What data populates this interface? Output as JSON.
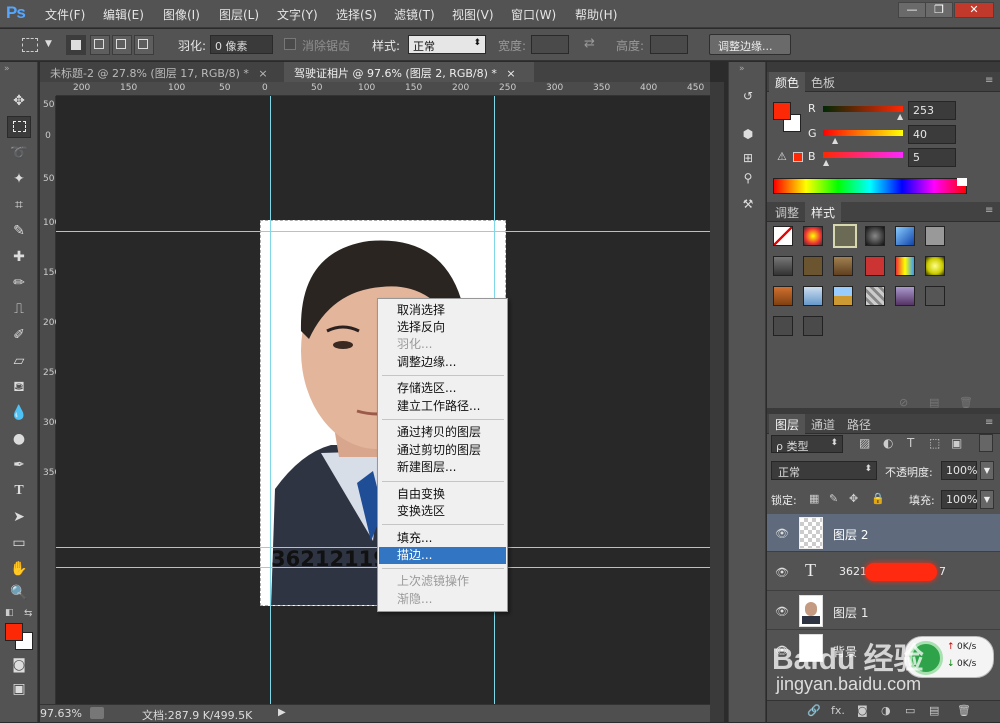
{
  "app": {
    "logo": "Ps"
  },
  "menubar": {
    "items": [
      "文件(F)",
      "编辑(E)",
      "图像(I)",
      "图层(L)",
      "文字(Y)",
      "选择(S)",
      "滤镜(T)",
      "视图(V)",
      "窗口(W)",
      "帮助(H)"
    ],
    "window_controls": [
      "—",
      "❐",
      "✕"
    ]
  },
  "options": {
    "feather_label": "羽化:",
    "feather_value": "0 像素",
    "antialias_label": "消除锯齿",
    "style_label": "样式:",
    "style_value": "正常",
    "width_label": "宽度:",
    "height_label": "高度:",
    "refine_button": "调整边缘..."
  },
  "tabs": [
    {
      "label": "未标题-2 @ 27.8% (图层 17, RGB/8) *",
      "close": "×"
    },
    {
      "label": "驾驶证相片 @ 97.6% (图层 2, RGB/8) *",
      "close": "×"
    }
  ],
  "ruler_top": [
    "200",
    "150",
    "100",
    "50",
    "0",
    "50",
    "100",
    "150",
    "200",
    "250",
    "300",
    "350",
    "400",
    "450"
  ],
  "ruler_left": [
    "50",
    "0",
    "50",
    "100",
    "150",
    "200",
    "250",
    "300",
    "350"
  ],
  "photo": {
    "id_text": "362121197"
  },
  "context_menu": {
    "groups": [
      [
        {
          "label": "取消选择",
          "enabled": true
        },
        {
          "label": "选择反向",
          "enabled": true
        },
        {
          "label": "羽化...",
          "enabled": false
        },
        {
          "label": "调整边缘...",
          "enabled": true
        }
      ],
      [
        {
          "label": "存储选区...",
          "enabled": true
        },
        {
          "label": "建立工作路径...",
          "enabled": true
        }
      ],
      [
        {
          "label": "通过拷贝的图层",
          "enabled": true
        },
        {
          "label": "通过剪切的图层",
          "enabled": true
        },
        {
          "label": "新建图层...",
          "enabled": true
        }
      ],
      [
        {
          "label": "自由变换",
          "enabled": true
        },
        {
          "label": "变换选区",
          "enabled": true
        }
      ],
      [
        {
          "label": "填充...",
          "enabled": true
        },
        {
          "label": "描边...",
          "enabled": true,
          "highlighted": true
        }
      ],
      [
        {
          "label": "上次滤镜操作",
          "enabled": false
        },
        {
          "label": "渐隐...",
          "enabled": false
        }
      ]
    ]
  },
  "status": {
    "zoom": "97.63%",
    "doc": "文档:287.9 K/499.5K"
  },
  "color_panel": {
    "tabs": [
      "颜色",
      "色板"
    ],
    "foreground": "#fd2805",
    "background": "#ffffff",
    "channels": [
      {
        "label": "R",
        "value": "253"
      },
      {
        "label": "G",
        "value": "40"
      },
      {
        "label": "B",
        "value": "5"
      }
    ]
  },
  "styles_panel": {
    "tabs": [
      "调整",
      "样式"
    ]
  },
  "layers_panel": {
    "tabs": [
      "图层",
      "通道",
      "路径"
    ],
    "filter_label": "ρ 类型",
    "blend_mode": "正常",
    "opacity_label": "不透明度:",
    "opacity_value": "100%",
    "lock_label": "锁定:",
    "fill_label": "填充:",
    "fill_value": "100%",
    "layers": [
      {
        "name": "图层 2",
        "type": "pixel",
        "selected": true
      },
      {
        "name": "3621",
        "suffix": "7",
        "type": "text",
        "selected": false
      },
      {
        "name": "图层 1",
        "type": "pixel",
        "selected": false
      },
      {
        "name": "背景",
        "type": "pixel",
        "selected": false
      }
    ]
  },
  "network": {
    "up": "0K/s",
    "down": "0K/s"
  },
  "watermark": {
    "brand": "Baidu 经验",
    "url": "jingyan.baidu.com"
  },
  "colors": {
    "accent_highlight": "#3276c3",
    "guide": "#7fd8e8"
  }
}
